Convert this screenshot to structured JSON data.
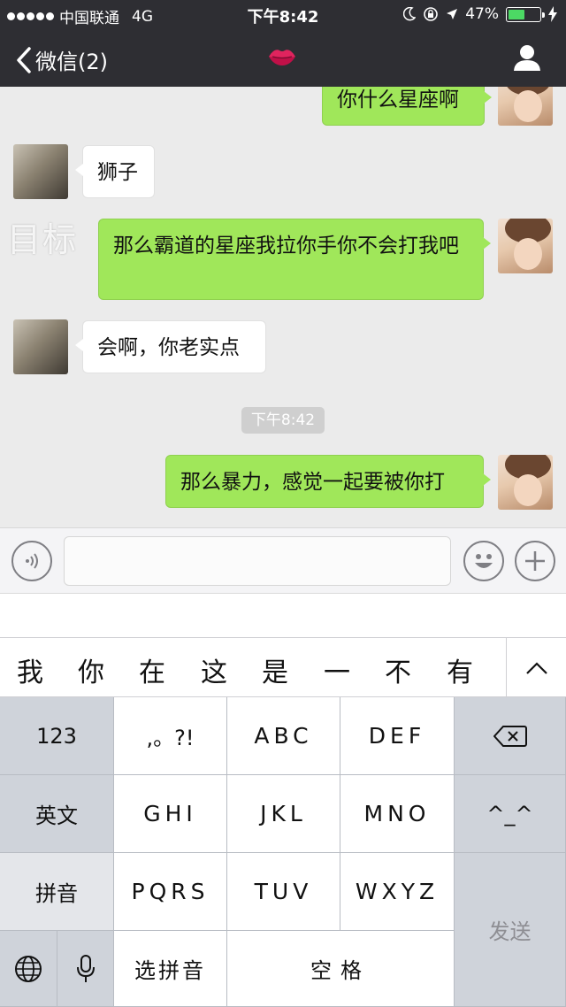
{
  "status_bar": {
    "signal_dots": 5,
    "carrier": "中国联通",
    "network": "4G",
    "time": "下午8:42",
    "battery_percent": "47%",
    "battery_level": 0.47,
    "icons": [
      "moon-icon",
      "rotation-lock-icon",
      "location-arrow-icon",
      "battery-icon",
      "charging-bolt-icon"
    ]
  },
  "nav": {
    "back_label": "微信(2)",
    "title_icon": "lips-emoji",
    "right_icon": "profile-icon"
  },
  "chat": {
    "watermark": "目标",
    "timestamp": "下午8:42",
    "messages": [
      {
        "side": "me",
        "text": "你什么星座啊"
      },
      {
        "side": "other",
        "text": "狮子"
      },
      {
        "side": "me",
        "text": "那么霸道的星座我拉你手你不会打我吧"
      },
      {
        "side": "other",
        "text": "会啊，你老实点"
      },
      {
        "side": "me",
        "text": "那么暴力，感觉一起要被你打"
      }
    ]
  },
  "input_bar": {
    "voice_icon": "voice-icon",
    "emoji_icon": "emoji-icon",
    "plus_icon": "plus-icon",
    "value": ""
  },
  "candidates": {
    "items": [
      "我",
      "你",
      "在",
      "这",
      "是",
      "一",
      "不",
      "有"
    ],
    "toggle_icon": "chevron-up-icon"
  },
  "keyboard": {
    "row1": [
      "123",
      ",。?!",
      "ABC",
      "DEF"
    ],
    "row2": [
      "英文",
      "GHI",
      "JKL",
      "MNO",
      "^_^"
    ],
    "row3": [
      "拼音",
      "PQRS",
      "TUV",
      "WXYZ"
    ],
    "row4": [
      "选拼音",
      "空格"
    ],
    "send": "发送",
    "delete_icon": "backspace-icon",
    "globe_icon": "globe-icon",
    "mic_icon": "microphone-icon"
  }
}
